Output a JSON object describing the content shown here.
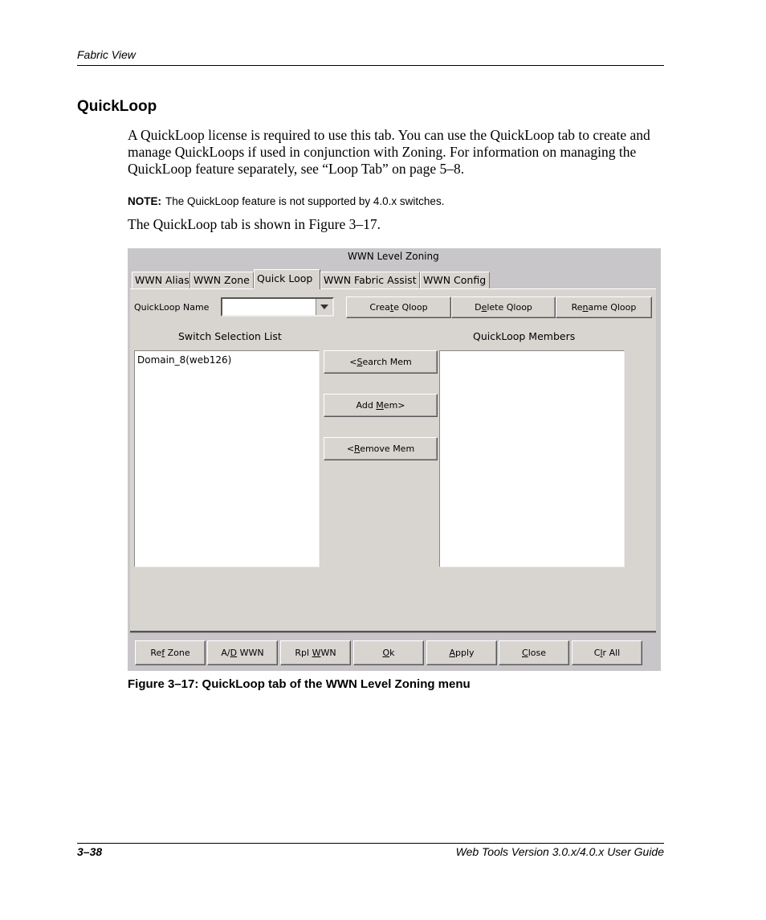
{
  "page": {
    "running_header": "Fabric View",
    "section_title": "QuickLoop",
    "paragraph1": "A QuickLoop license is required to use this tab. You can use the QuickLoop tab to create and manage QuickLoops if used in conjunction with Zoning. For information on managing the QuickLoop feature separately, see “Loop Tab” on page 5–8.",
    "note_label": "NOTE:",
    "note_text": "The QuickLoop feature is not supported by 4.0.x switches.",
    "paragraph2": "The QuickLoop tab is shown in Figure 3–17.",
    "figure_caption": "Figure 3–17:  QuickLoop tab of the WWN Level Zoning menu",
    "footer_page": "3–38",
    "footer_title": "Web Tools Version 3.0.x/4.0.x User Guide"
  },
  "window": {
    "title": "WWN Level Zoning",
    "tabs": [
      {
        "label": "WWN Alias",
        "active": false
      },
      {
        "label": "WWN Zone",
        "active": false
      },
      {
        "label": "Quick Loop",
        "active": true
      },
      {
        "label": "WWN Fabric Assist",
        "active": false
      },
      {
        "label": "WWN Config",
        "active": false
      }
    ],
    "quickloop_name_label": "QuickLoop Name",
    "quickloop_name_value": "",
    "top_buttons": {
      "create": {
        "pre": "Crea",
        "mn": "t",
        "post": "e Qloop"
      },
      "delete": {
        "pre": "D",
        "mn": "e",
        "post": "lete Qloop"
      },
      "rename": {
        "pre": "Re",
        "mn": "n",
        "post": "ame Qloop"
      }
    },
    "switch_list_label": "Switch Selection List",
    "switch_list_items": [
      "Domain_8(web126)"
    ],
    "members_label": "QuickLoop Members",
    "members_items": [],
    "mid_buttons": {
      "search": {
        "pre": "<",
        "mn": "S",
        "post": "earch Mem"
      },
      "add": {
        "pre": "Add ",
        "mn": "M",
        "post": "em>"
      },
      "remove": {
        "pre": "<",
        "mn": "R",
        "post": "emove Mem"
      }
    },
    "bottom_buttons": {
      "ref_zone": {
        "pre": "Re",
        "mn": "f",
        "post": " Zone"
      },
      "ad_wwn": {
        "pre": "A/",
        "mn": "D",
        "post": " WWN"
      },
      "rpl_wwn": {
        "pre": "Rpl ",
        "mn": "W",
        "post": "WN"
      },
      "ok": {
        "pre": "",
        "mn": "O",
        "post": "k"
      },
      "apply": {
        "pre": "",
        "mn": "A",
        "post": "pply"
      },
      "close": {
        "pre": "",
        "mn": "C",
        "post": "lose"
      },
      "clr_all": {
        "pre": "C",
        "mn": "l",
        "post": "r All"
      }
    }
  }
}
